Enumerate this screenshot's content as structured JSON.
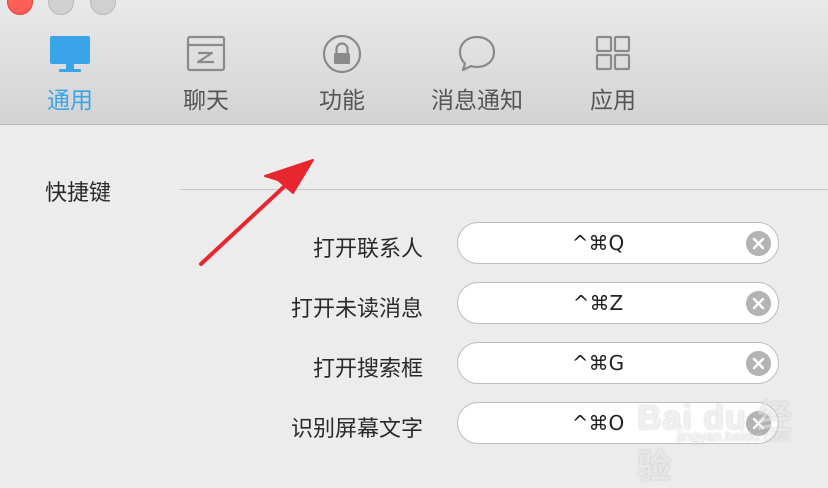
{
  "toolbar": {
    "tabs": [
      {
        "label": "通用",
        "icon": "monitor-icon",
        "active": true
      },
      {
        "label": "聊天",
        "icon": "chat-window-icon",
        "active": false
      },
      {
        "label": "功能",
        "icon": "lock-icon",
        "active": false
      },
      {
        "label": "消息通知",
        "icon": "speech-bubble-icon",
        "active": false
      },
      {
        "label": "应用",
        "icon": "apps-grid-icon",
        "active": false
      }
    ],
    "active_color": "#3aa4e8"
  },
  "section": {
    "title": "快捷键",
    "shortcuts": [
      {
        "label": "打开联系人",
        "value": "^⌘Q"
      },
      {
        "label": "打开未读消息",
        "value": "^⌘Z"
      },
      {
        "label": "打开搜索框",
        "value": "^⌘G"
      },
      {
        "label": "识别屏幕文字",
        "value": "^⌘O"
      }
    ]
  },
  "annotation": {
    "arrow_color": "#e8262f"
  },
  "watermark": {
    "brand": "Bai du 经验",
    "url": "jingyan.baidu.com"
  }
}
